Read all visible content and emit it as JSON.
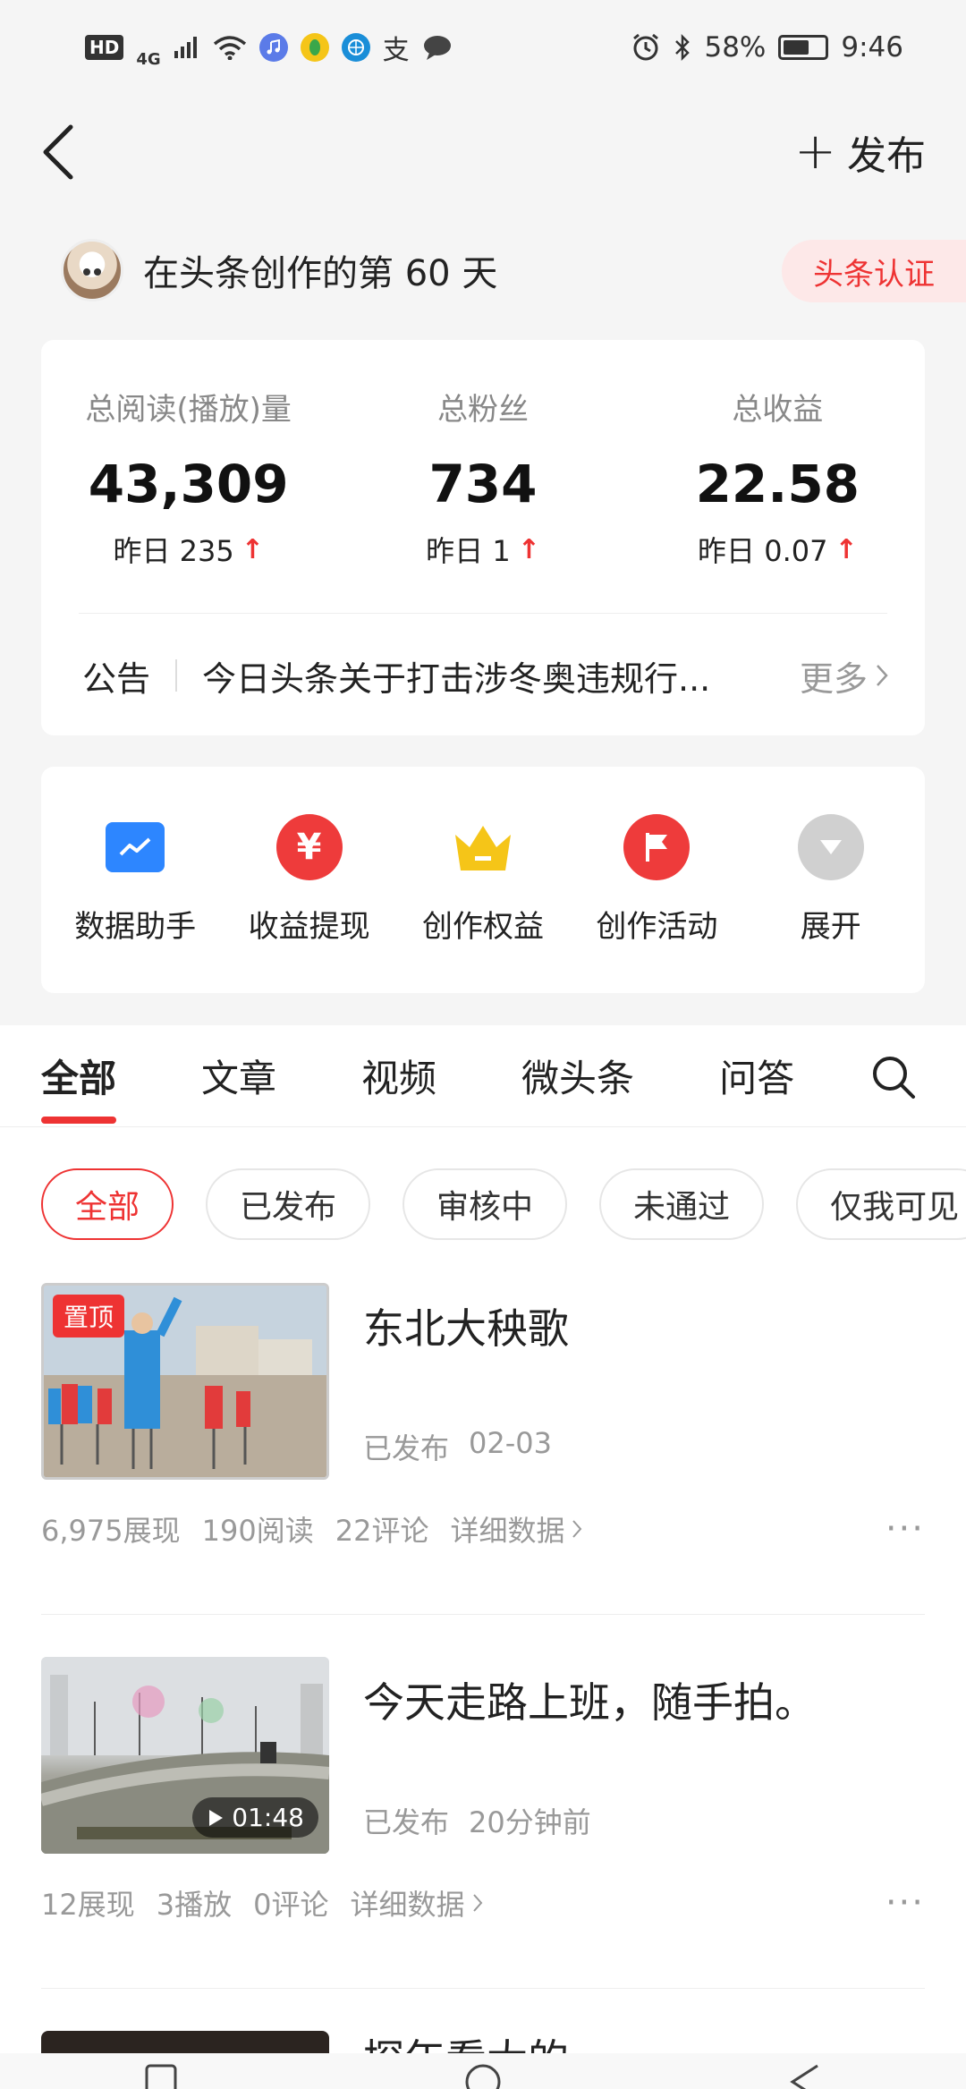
{
  "status_bar": {
    "network": "4G",
    "battery": "58%",
    "time": "9:46",
    "hd": "HD",
    "pay_glyph": "支"
  },
  "topbar": {
    "back_icon": "chevron-left-icon",
    "publish_plus": "+",
    "publish_label": "发布"
  },
  "user": {
    "creation_text": "在头条创作的第 60 天",
    "cert_label": "头条认证"
  },
  "stats": [
    {
      "label": "总阅读(播放)量",
      "value": "43,309",
      "delta": "昨日 235"
    },
    {
      "label": "总粉丝",
      "value": "734",
      "delta": "昨日 1"
    },
    {
      "label": "总收益",
      "value": "22.58",
      "delta": "昨日 0.07"
    }
  ],
  "notice": {
    "label": "公告",
    "text": "今日头条关于打击涉冬奥违规行...",
    "more": "更多"
  },
  "tools": [
    {
      "label": "数据助手",
      "icon": "chart-icon",
      "color": "#2d86ff"
    },
    {
      "label": "收益提现",
      "icon": "yen-icon",
      "color": "#ee3b3b"
    },
    {
      "label": "创作权益",
      "icon": "crown-icon",
      "color": "#f5c518"
    },
    {
      "label": "创作活动",
      "icon": "flag-icon",
      "color": "#ee3b3b"
    },
    {
      "label": "展开",
      "icon": "expand-icon",
      "color": "#d0d0d0"
    }
  ],
  "tool_glyphs": {
    "yen": "¥"
  },
  "tabs": [
    "全部",
    "文章",
    "视频",
    "微头条",
    "问答"
  ],
  "filters": [
    "全部",
    "已发布",
    "审核中",
    "未通过",
    "仅我可见"
  ],
  "posts": [
    {
      "title": "东北大秧歌",
      "pin": "置顶",
      "status": "已发布",
      "date": "02-03",
      "stats": [
        "6,975展现",
        "190阅读",
        "22评论"
      ],
      "detail": "详细数据"
    },
    {
      "title": "今天走路上班，随手拍。",
      "duration": "01:48",
      "status": "已发布",
      "date": "20分钟前",
      "stats": [
        "12展现",
        "3播放",
        "0评论"
      ],
      "detail": "详细数据"
    }
  ],
  "partial_post_title": "探年看大的",
  "more_dots": "···",
  "colors": {
    "accent": "#e33333",
    "muted": "#999999"
  }
}
